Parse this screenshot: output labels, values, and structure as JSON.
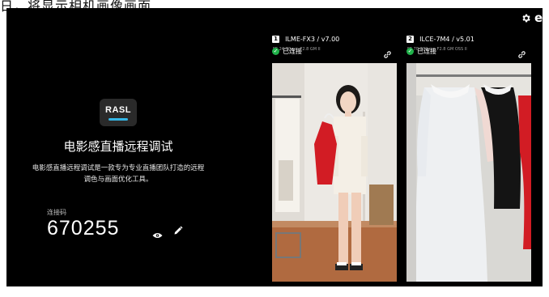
{
  "caption": "日，将显示相机画像画面",
  "app": {
    "logo_text": "RASL",
    "title": "电影感直播远程调试",
    "description_line1": "电影感直播远程调试是一款专为专业直播团队打造的远程",
    "description_line2": "调色与画面优化工具。",
    "code_label": "连接码",
    "code_value": "670255",
    "profile_letter": "e"
  },
  "cameras": [
    {
      "badge": "1",
      "name": "ILME-FX3 / v7.00",
      "lens": "FE 24-70mm F2.8 GM II",
      "status": "已连接"
    },
    {
      "badge": "2",
      "name": "ILCE-7M4 / v5.01",
      "lens": "FE 70-200mm F2.8 GM OSS II",
      "status": "已连接"
    }
  ],
  "colors": {
    "background": "#000000",
    "accent": "#34b6e6",
    "connected": "#20b24a",
    "dress_red": "#d21c24"
  },
  "icons": [
    "settings-icon",
    "eye-icon",
    "pencil-icon",
    "check-icon",
    "link-icon"
  ]
}
